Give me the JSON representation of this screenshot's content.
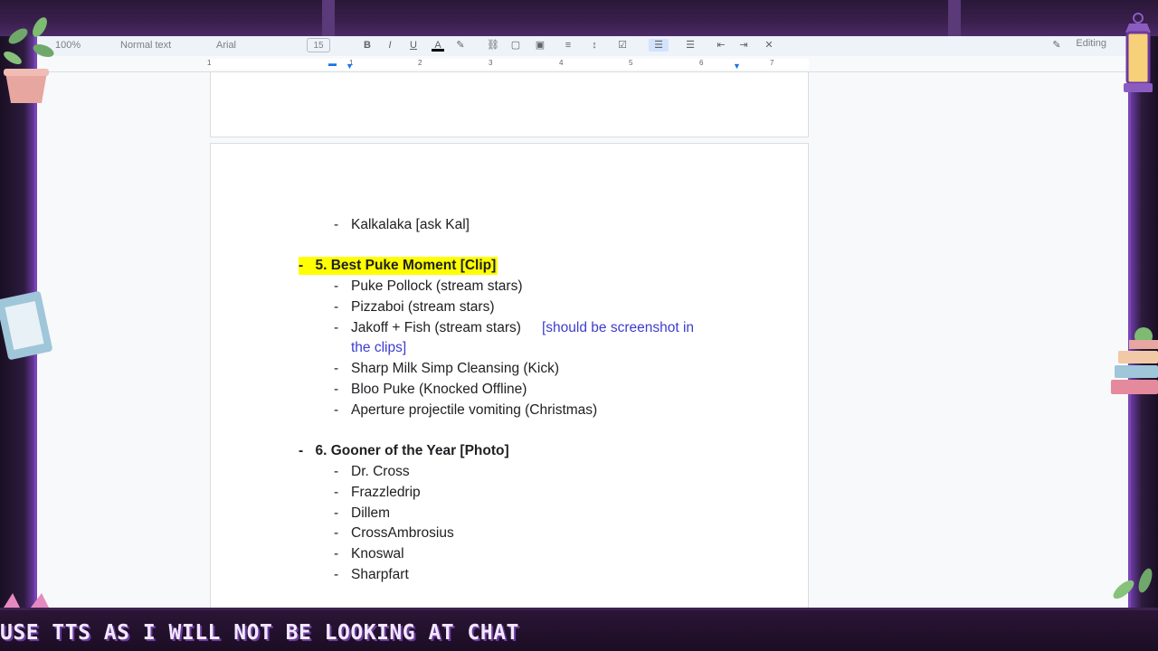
{
  "toolbar": {
    "zoom": "100%",
    "style": "Normal text",
    "font": "Arial",
    "size": "15",
    "mode": "Editing"
  },
  "ruler": {
    "numbers": [
      "1",
      "1",
      "2",
      "3",
      "4",
      "5",
      "6",
      "7"
    ]
  },
  "document": {
    "lines": [
      {
        "dash": "-",
        "text": "Kalkalaka [ask Kal]"
      },
      {
        "dash": "-",
        "text": "5. Best Puke Moment [Clip]"
      },
      {
        "dash": "-",
        "text": "Puke Pollock (stream stars)"
      },
      {
        "dash": "-",
        "text": "Pizzaboi (stream stars)"
      },
      {
        "dash": "-",
        "text": "Jakoff + Fish (stream stars)",
        "note_line1": "[should be screenshot in",
        "note_line2": "the clips]"
      },
      {
        "dash": "-",
        "text": "Sharp Milk Simp Cleansing (Kick)"
      },
      {
        "dash": "-",
        "text": "Bloo Puke (Knocked Offline)"
      },
      {
        "dash": "-",
        "text": "Aperture projectile vomiting (Christmas)"
      },
      {
        "dash": "-",
        "text": "6. Gooner of the Year [Photo]"
      },
      {
        "dash": "-",
        "text": "Dr. Cross"
      },
      {
        "dash": "-",
        "text": "Frazzledrip"
      },
      {
        "dash": "-",
        "text": "Dillem"
      },
      {
        "dash": "-",
        "text": "CrossAmbrosius"
      },
      {
        "dash": "-",
        "text": "Knoswal"
      },
      {
        "dash": "-",
        "text": "Sharpfart"
      }
    ]
  },
  "ticker": {
    "text": "USE TTS AS I WILL NOT BE LOOKING AT CHAT"
  },
  "colors": {
    "highlight": "#ffff00",
    "link": "#3c3cd0",
    "frame_purple": "#7a45b8"
  },
  "icons": [
    "bold-icon",
    "italic-icon",
    "underline-icon",
    "text-color-icon",
    "highlight-icon",
    "link-icon",
    "comment-icon",
    "image-icon",
    "align-icon",
    "line-spacing-icon",
    "checklist-icon",
    "bulleted-list-icon",
    "numbered-list-icon",
    "indent-decrease-icon",
    "indent-increase-icon",
    "clear-format-icon",
    "pencil-icon"
  ]
}
